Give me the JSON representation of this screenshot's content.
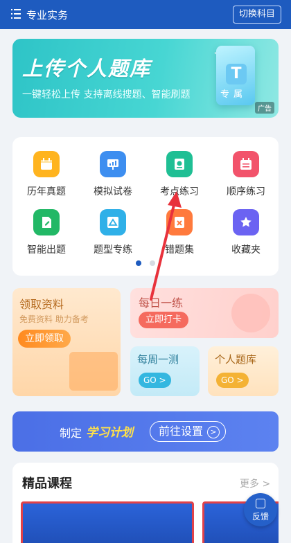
{
  "header": {
    "title": "专业实务",
    "switch_label": "切换科目"
  },
  "banner": {
    "title": "上传个人题库",
    "subtitle": "一键轻松上传 支持离线搜题、智能刷题",
    "doc_letter": "T",
    "doc_caption": "专属",
    "ad_label": "广告"
  },
  "grid": {
    "items": [
      {
        "label": "历年真题",
        "icon": "calendar-icon",
        "color": "#ffb41f"
      },
      {
        "label": "模拟试卷",
        "icon": "presentation-icon",
        "color": "#3d8ef0"
      },
      {
        "label": "考点练习",
        "icon": "badge-icon",
        "color": "#1fbf94"
      },
      {
        "label": "顺序练习",
        "icon": "calendar-list-icon",
        "color": "#f2536b"
      },
      {
        "label": "智能出题",
        "icon": "edit-doc-icon",
        "color": "#22b866"
      },
      {
        "label": "题型专练",
        "icon": "triangle-icon",
        "color": "#2fb0e8"
      },
      {
        "label": "错题集",
        "icon": "wrong-doc-icon",
        "color": "#ff7a3d"
      },
      {
        "label": "收藏夹",
        "icon": "star-icon",
        "color": "#6b63f2"
      }
    ],
    "page_dots": {
      "active_color": "#1e5bbf",
      "inactive_color": "#d6dbe3"
    }
  },
  "cards": {
    "lingqu": {
      "title": "领取资料",
      "subtitle": "免费资料 助力备考",
      "button": "立即领取"
    },
    "meiri": {
      "title": "每日一练",
      "button": "立即打卡"
    },
    "meizhou": {
      "title": "每周一测",
      "button": "GO >"
    },
    "geren": {
      "title": "个人题库",
      "button": "GO >"
    }
  },
  "plan": {
    "prefix": "制定",
    "highlight": "学习计划",
    "button": "前往设置",
    "arrow": ">"
  },
  "course": {
    "title": "精品课程",
    "more": "更多 >"
  },
  "feedback": {
    "label": "反馈"
  },
  "colors": {
    "brand": "#1e5bbf",
    "annotation_arrow": "#e8323c"
  }
}
